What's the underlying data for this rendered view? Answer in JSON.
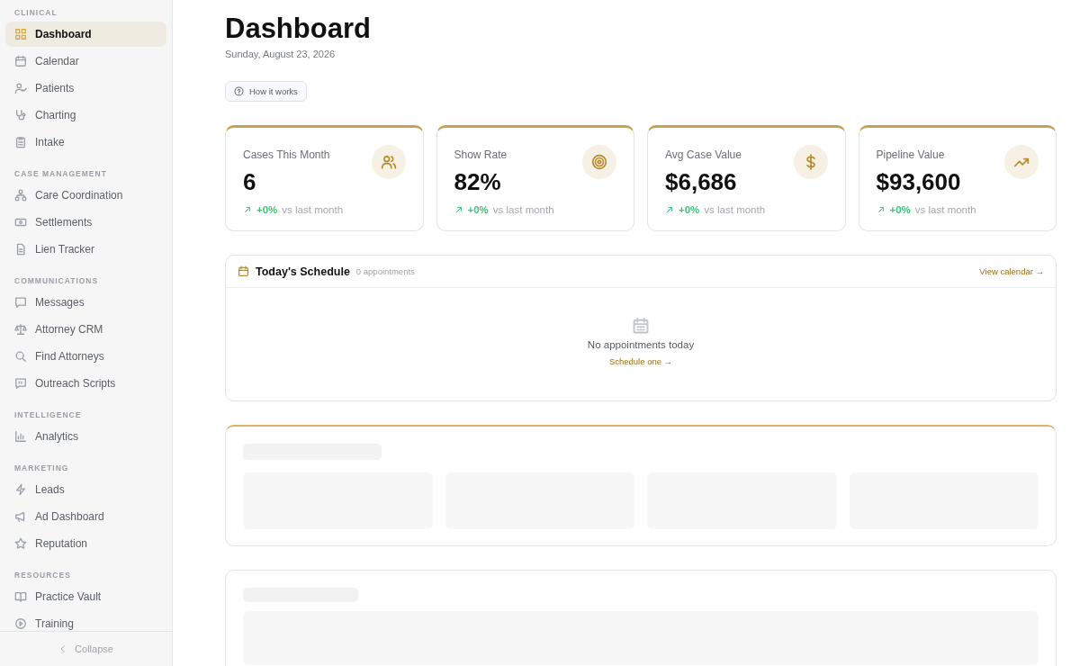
{
  "sidebar": {
    "sections": [
      {
        "label": "CLINICAL",
        "items": [
          {
            "label": "Dashboard",
            "selected": true
          },
          {
            "label": "Calendar",
            "selected": false
          },
          {
            "label": "Patients",
            "selected": false
          },
          {
            "label": "Charting",
            "selected": false
          },
          {
            "label": "Intake",
            "selected": false
          }
        ]
      },
      {
        "label": "CASE MANAGEMENT",
        "items": [
          {
            "label": "Care Coordination",
            "selected": false
          },
          {
            "label": "Settlements",
            "selected": false
          },
          {
            "label": "Lien Tracker",
            "selected": false
          }
        ]
      },
      {
        "label": "COMMUNICATIONS",
        "items": [
          {
            "label": "Messages",
            "selected": false
          },
          {
            "label": "Attorney CRM",
            "selected": false
          },
          {
            "label": "Find Attorneys",
            "selected": false
          },
          {
            "label": "Outreach Scripts",
            "selected": false
          }
        ]
      },
      {
        "label": "INTELLIGENCE",
        "items": [
          {
            "label": "Analytics",
            "selected": false
          }
        ]
      },
      {
        "label": "MARKETING",
        "items": [
          {
            "label": "Leads",
            "selected": false
          },
          {
            "label": "Ad Dashboard",
            "selected": false
          },
          {
            "label": "Reputation",
            "selected": false
          }
        ]
      },
      {
        "label": "RESOURCES",
        "items": [
          {
            "label": "Practice Vault",
            "selected": false
          },
          {
            "label": "Training",
            "selected": false
          }
        ]
      }
    ],
    "collapse": "Collapse"
  },
  "header": {
    "title": "Dashboard",
    "date": "Sunday, August 23, 2026",
    "help_button": "How it works"
  },
  "stats": [
    {
      "label": "Cases This Month",
      "value": "6",
      "change": "+0%",
      "suffix": "vs last month"
    },
    {
      "label": "Show Rate",
      "value": "82%",
      "change": "+0%",
      "suffix": "vs last month"
    },
    {
      "label": "Avg Case Value",
      "value": "$6,686",
      "change": "+0%",
      "suffix": "vs last month"
    },
    {
      "label": "Pipeline Value",
      "value": "$93,600",
      "change": "+0%",
      "suffix": "vs last month"
    }
  ],
  "schedule": {
    "title": "Today's Schedule",
    "count": "0 appointments",
    "link": "View calendar →",
    "empty_text": "No appointments today",
    "empty_link": "Schedule one →"
  },
  "loading_panels": [
    {
      "kind": "stats"
    },
    {
      "kind": "list"
    }
  ]
}
